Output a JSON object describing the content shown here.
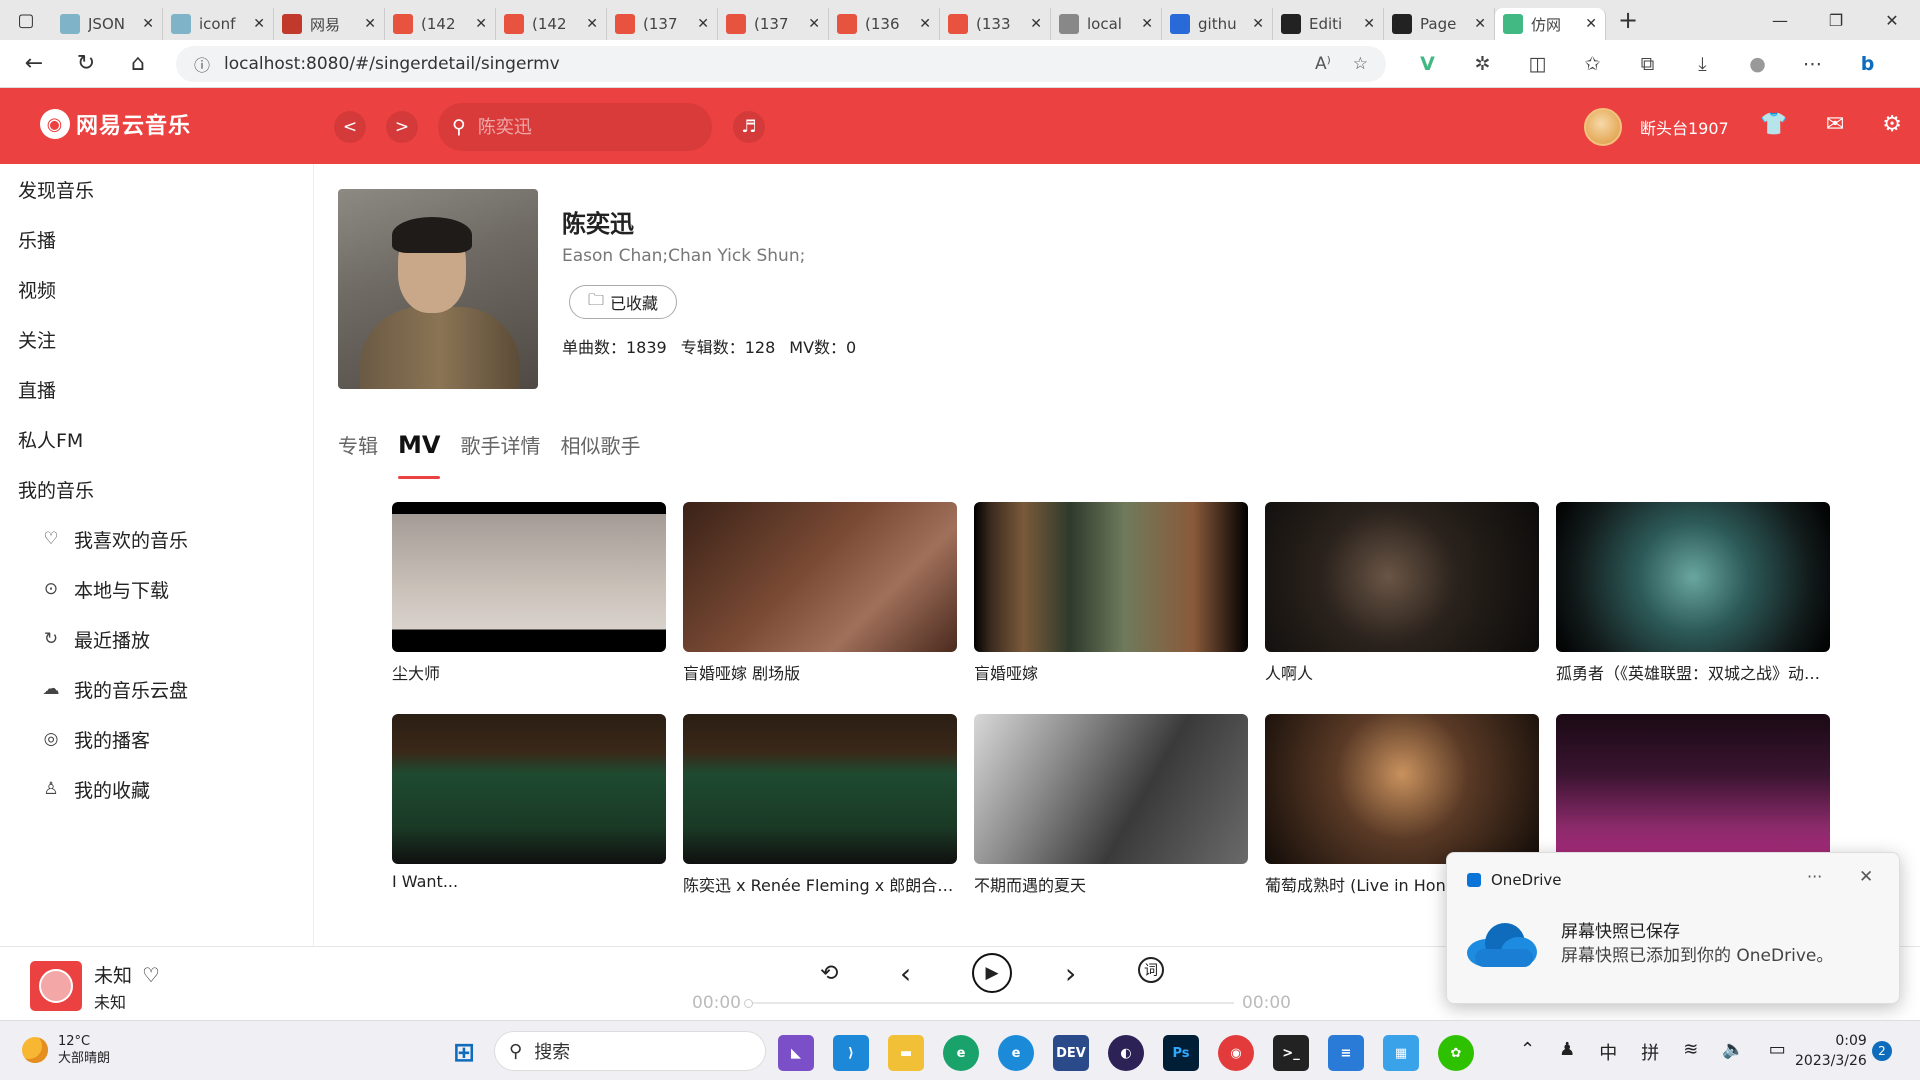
{
  "browser": {
    "tabs": [
      {
        "title": "JSON",
        "color": "#7fb3c7"
      },
      {
        "title": "iconf",
        "color": "#7fb3c7"
      },
      {
        "title": "网易",
        "color": "#c0392b"
      },
      {
        "title": "(142",
        "color": "#e8533f"
      },
      {
        "title": "(142",
        "color": "#e8533f"
      },
      {
        "title": "(137",
        "color": "#e8533f"
      },
      {
        "title": "(137",
        "color": "#e8533f"
      },
      {
        "title": "(136",
        "color": "#e8533f"
      },
      {
        "title": "(133",
        "color": "#e8533f"
      },
      {
        "title": "local",
        "color": "#888888"
      },
      {
        "title": "githu",
        "color": "#2a6ad8"
      },
      {
        "title": "Editi",
        "color": "#222222"
      },
      {
        "title": "Page",
        "color": "#222222"
      },
      {
        "title": "仿网",
        "color": "#42b883"
      }
    ],
    "url": "localhost:8080/#/singerdetail/singermv"
  },
  "app": {
    "logo_text": "网易云音乐",
    "search_placeholder": "陈奕迅",
    "username": "断头台1907"
  },
  "sidebar": {
    "items": [
      "发现音乐",
      "乐播",
      "视频",
      "关注",
      "直播",
      "私人FM",
      "我的音乐"
    ],
    "sub_items": [
      {
        "label": "我喜欢的音乐",
        "icon": "heart-icon",
        "glyph": "♡"
      },
      {
        "label": "本地与下载",
        "icon": "download-icon",
        "glyph": "⊙"
      },
      {
        "label": "最近播放",
        "icon": "history-icon",
        "glyph": "↻"
      },
      {
        "label": "我的音乐云盘",
        "icon": "cloud-icon",
        "glyph": "☁"
      },
      {
        "label": "我的播客",
        "icon": "podcast-icon",
        "glyph": "◎"
      },
      {
        "label": "我的收藏",
        "icon": "user-icon",
        "glyph": "♙"
      }
    ]
  },
  "singer": {
    "name": "陈奕迅",
    "alias": "Eason Chan;Chan Yick Shun;",
    "fav_label": "已收藏",
    "stats": {
      "songs_label": "单曲数：1839",
      "albums_label": "专辑数：128",
      "mv_label": "MV数：0"
    }
  },
  "tabs": [
    "专辑",
    "MV",
    "歌手详情",
    "相似歌手"
  ],
  "active_tab": "MV",
  "mvs": [
    {
      "title": "尘大师",
      "bg": "linear-gradient(180deg,#000 0%,#000 8%,#a39b95 8%,#c8bfb7 55%,#d9d2cc 85%,#000 85%)"
    },
    {
      "title": "盲婚哑嫁 剧场版",
      "bg": "linear-gradient(135deg,#3a2218 0%,#7a4a34 45%,#a0705a 70%,#4a2a1e 100%)"
    },
    {
      "title": "盲婚哑嫁",
      "bg": "linear-gradient(90deg,#000 0%,#3a2a1e 6%,#7a5a3a 18%,#2e3a2c 35%,#6f7a5c 55%,#8a5a3a 80%,#000 100%)"
    },
    {
      "title": "人啊人",
      "bg": "radial-gradient(circle at 45% 50%,#6a5545 0%,#2a221c 40%,#0c0b0a 100%)"
    },
    {
      "title": "孤勇者（《英雄联盟：双城之战》动画剧集中文主题曲）",
      "bg": "radial-gradient(circle at 50% 50%,#6aa6a0 0%,#2c5a58 35%,#121a1a 75%,#000 100%)"
    },
    {
      "title": "I Want...",
      "bg": "linear-gradient(180deg,#2a1e14 0%,#3a2818 25%,#1e4a30 40%,#1a3a26 75%,#101010 100%)"
    },
    {
      "title": "陈奕迅 x Renée Fleming x 郎朗合作单曲",
      "bg": "linear-gradient(180deg,#2a1e14 0%,#3a2818 25%,#1e4a30 40%,#1a3a26 75%,#101010 100%)"
    },
    {
      "title": "不期而遇的夏天",
      "bg": "linear-gradient(120deg,#d8d8d8 0%,#8c8c8c 30%,#3a3a3a 60%,#6a6a6a 100%)"
    },
    {
      "title": "葡萄成熟时 (Live in Hong Kong)",
      "bg": "radial-gradient(circle at 50% 40%,#c9925e 0%,#5a3a26 40%,#120c08 100%)"
    },
    {
      "title": "",
      "bg": "linear-gradient(180deg,#1a0a14 0%,#3a1430 40%,#8a2a6a 75%,#b02a80 100%)"
    }
  ],
  "player": {
    "title": "未知",
    "artist": "未知",
    "current_time": "00:00",
    "total_time": "00:00",
    "lyric_label": "词"
  },
  "toast": {
    "app": "OneDrive",
    "title": "屏幕快照已保存",
    "message": "屏幕快照已添加到你的 OneDrive。"
  },
  "taskbar": {
    "temp": "12°C",
    "weather": "大部晴朗",
    "search_placeholder": "搜索",
    "ime_lang": "中",
    "ime_mode": "拼",
    "time": "0:09",
    "date": "2023/3/26",
    "notif_count": "2"
  }
}
